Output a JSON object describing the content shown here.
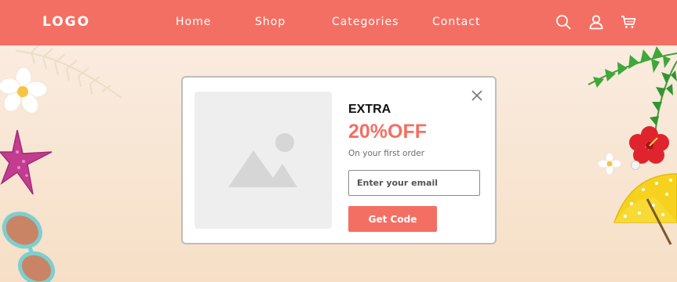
{
  "header": {
    "logo": "LOGO",
    "nav": [
      {
        "label": "Home"
      },
      {
        "label": "Shop"
      },
      {
        "label": "Categories"
      },
      {
        "label": "Contact"
      }
    ],
    "icons": [
      "search-icon",
      "user-icon",
      "cart-icon"
    ]
  },
  "popup": {
    "headline": "EXTRA",
    "offer": "20%OFF",
    "subtext": "On your first order",
    "email_placeholder": "Enter your email",
    "email_value": "",
    "button_label": "Get Code",
    "image_icon": "image-placeholder-icon",
    "close_icon": "close-icon"
  },
  "colors": {
    "brand": "#f46f63",
    "header_bg": "#f46f63",
    "page_bg": "#f8e6d4"
  }
}
